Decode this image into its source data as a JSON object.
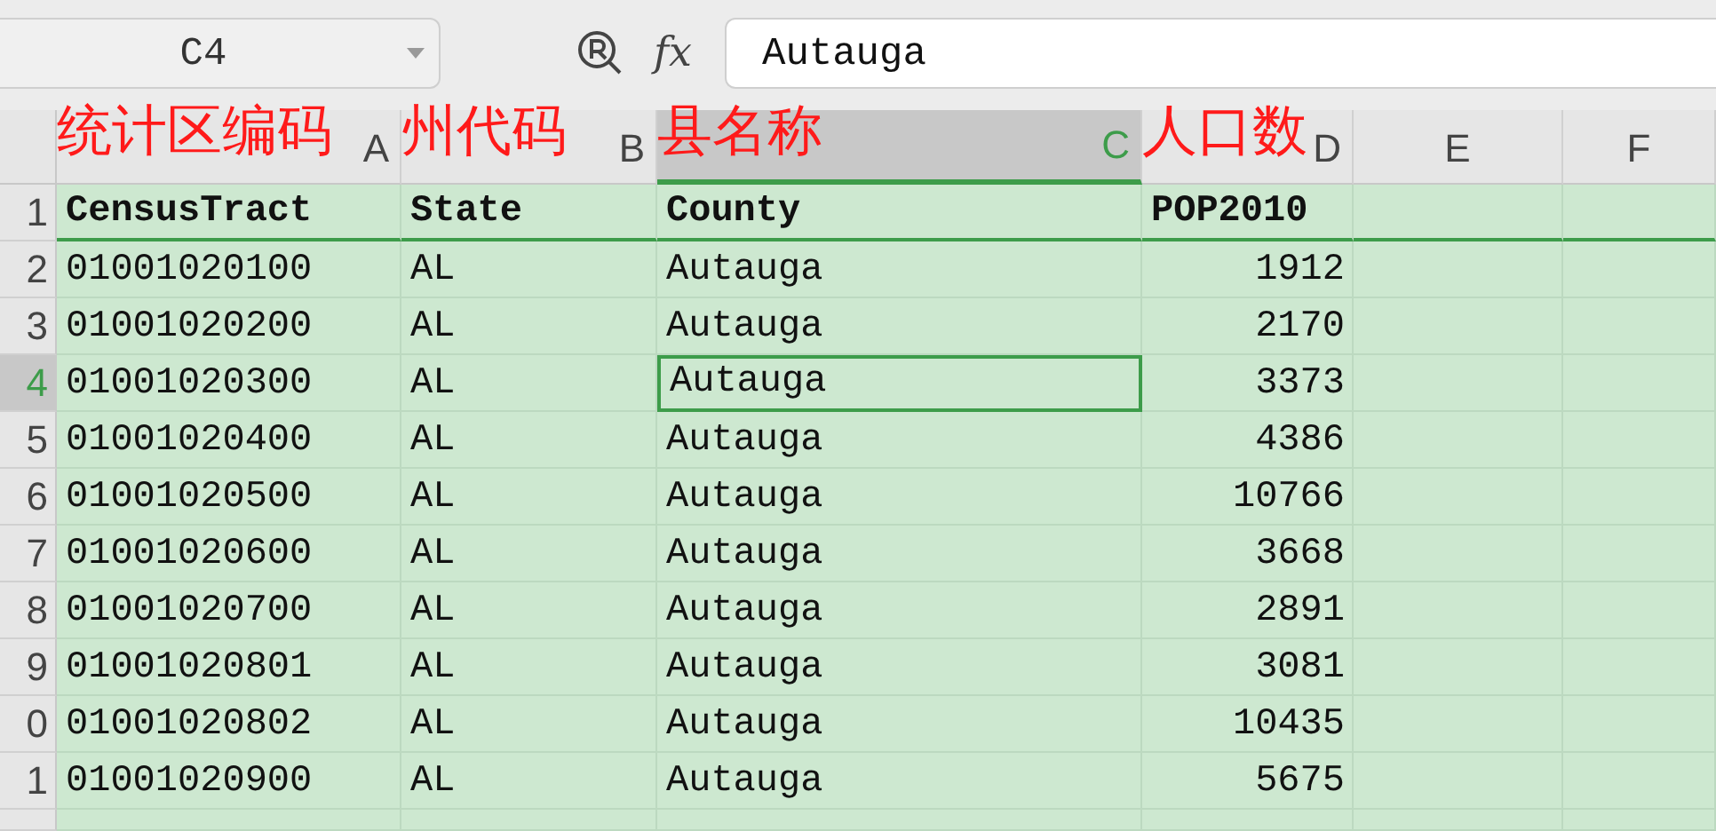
{
  "formula_bar": {
    "name_box": "C4",
    "function_label": "fx",
    "formula": "Autauga"
  },
  "columns": [
    {
      "label": "A",
      "selected": false,
      "kind": "text",
      "annotation": "统计区编码"
    },
    {
      "label": "B",
      "selected": false,
      "kind": "text",
      "annotation": "州代码"
    },
    {
      "label": "C",
      "selected": true,
      "kind": "text",
      "annotation": "县名称"
    },
    {
      "label": "D",
      "selected": false,
      "kind": "number",
      "annotation": "人口数"
    },
    {
      "label": "E",
      "selected": false,
      "kind": "text"
    },
    {
      "label": "F",
      "selected": false,
      "kind": "text"
    }
  ],
  "rows": [
    {
      "number": "1",
      "selected": false,
      "kind": "header",
      "cells": [
        "CensusTract",
        "State",
        "County",
        "POP2010"
      ]
    },
    {
      "number": "2",
      "selected": false,
      "cells": [
        "01001020100",
        "AL",
        "Autauga",
        "1912"
      ]
    },
    {
      "number": "3",
      "selected": false,
      "cells": [
        "01001020200",
        "AL",
        "Autauga",
        "2170"
      ]
    },
    {
      "number": "4",
      "selected": true,
      "cells": [
        "01001020300",
        "AL",
        "Autauga",
        "3373"
      ]
    },
    {
      "number": "5",
      "selected": false,
      "cells": [
        "01001020400",
        "AL",
        "Autauga",
        "4386"
      ]
    },
    {
      "number": "6",
      "selected": false,
      "cells": [
        "01001020500",
        "AL",
        "Autauga",
        "10766"
      ]
    },
    {
      "number": "7",
      "selected": false,
      "cells": [
        "01001020600",
        "AL",
        "Autauga",
        "3668"
      ]
    },
    {
      "number": "8",
      "selected": false,
      "cells": [
        "01001020700",
        "AL",
        "Autauga",
        "2891"
      ]
    },
    {
      "number": "9",
      "selected": false,
      "cells": [
        "01001020801",
        "AL",
        "Autauga",
        "3081"
      ]
    },
    {
      "number": "0",
      "selected": false,
      "cells": [
        "01001020802",
        "AL",
        "Autauga",
        "10435"
      ]
    },
    {
      "number": "1",
      "selected": false,
      "cells": [
        "01001020900",
        "AL",
        "Autauga",
        "5675"
      ]
    }
  ]
}
